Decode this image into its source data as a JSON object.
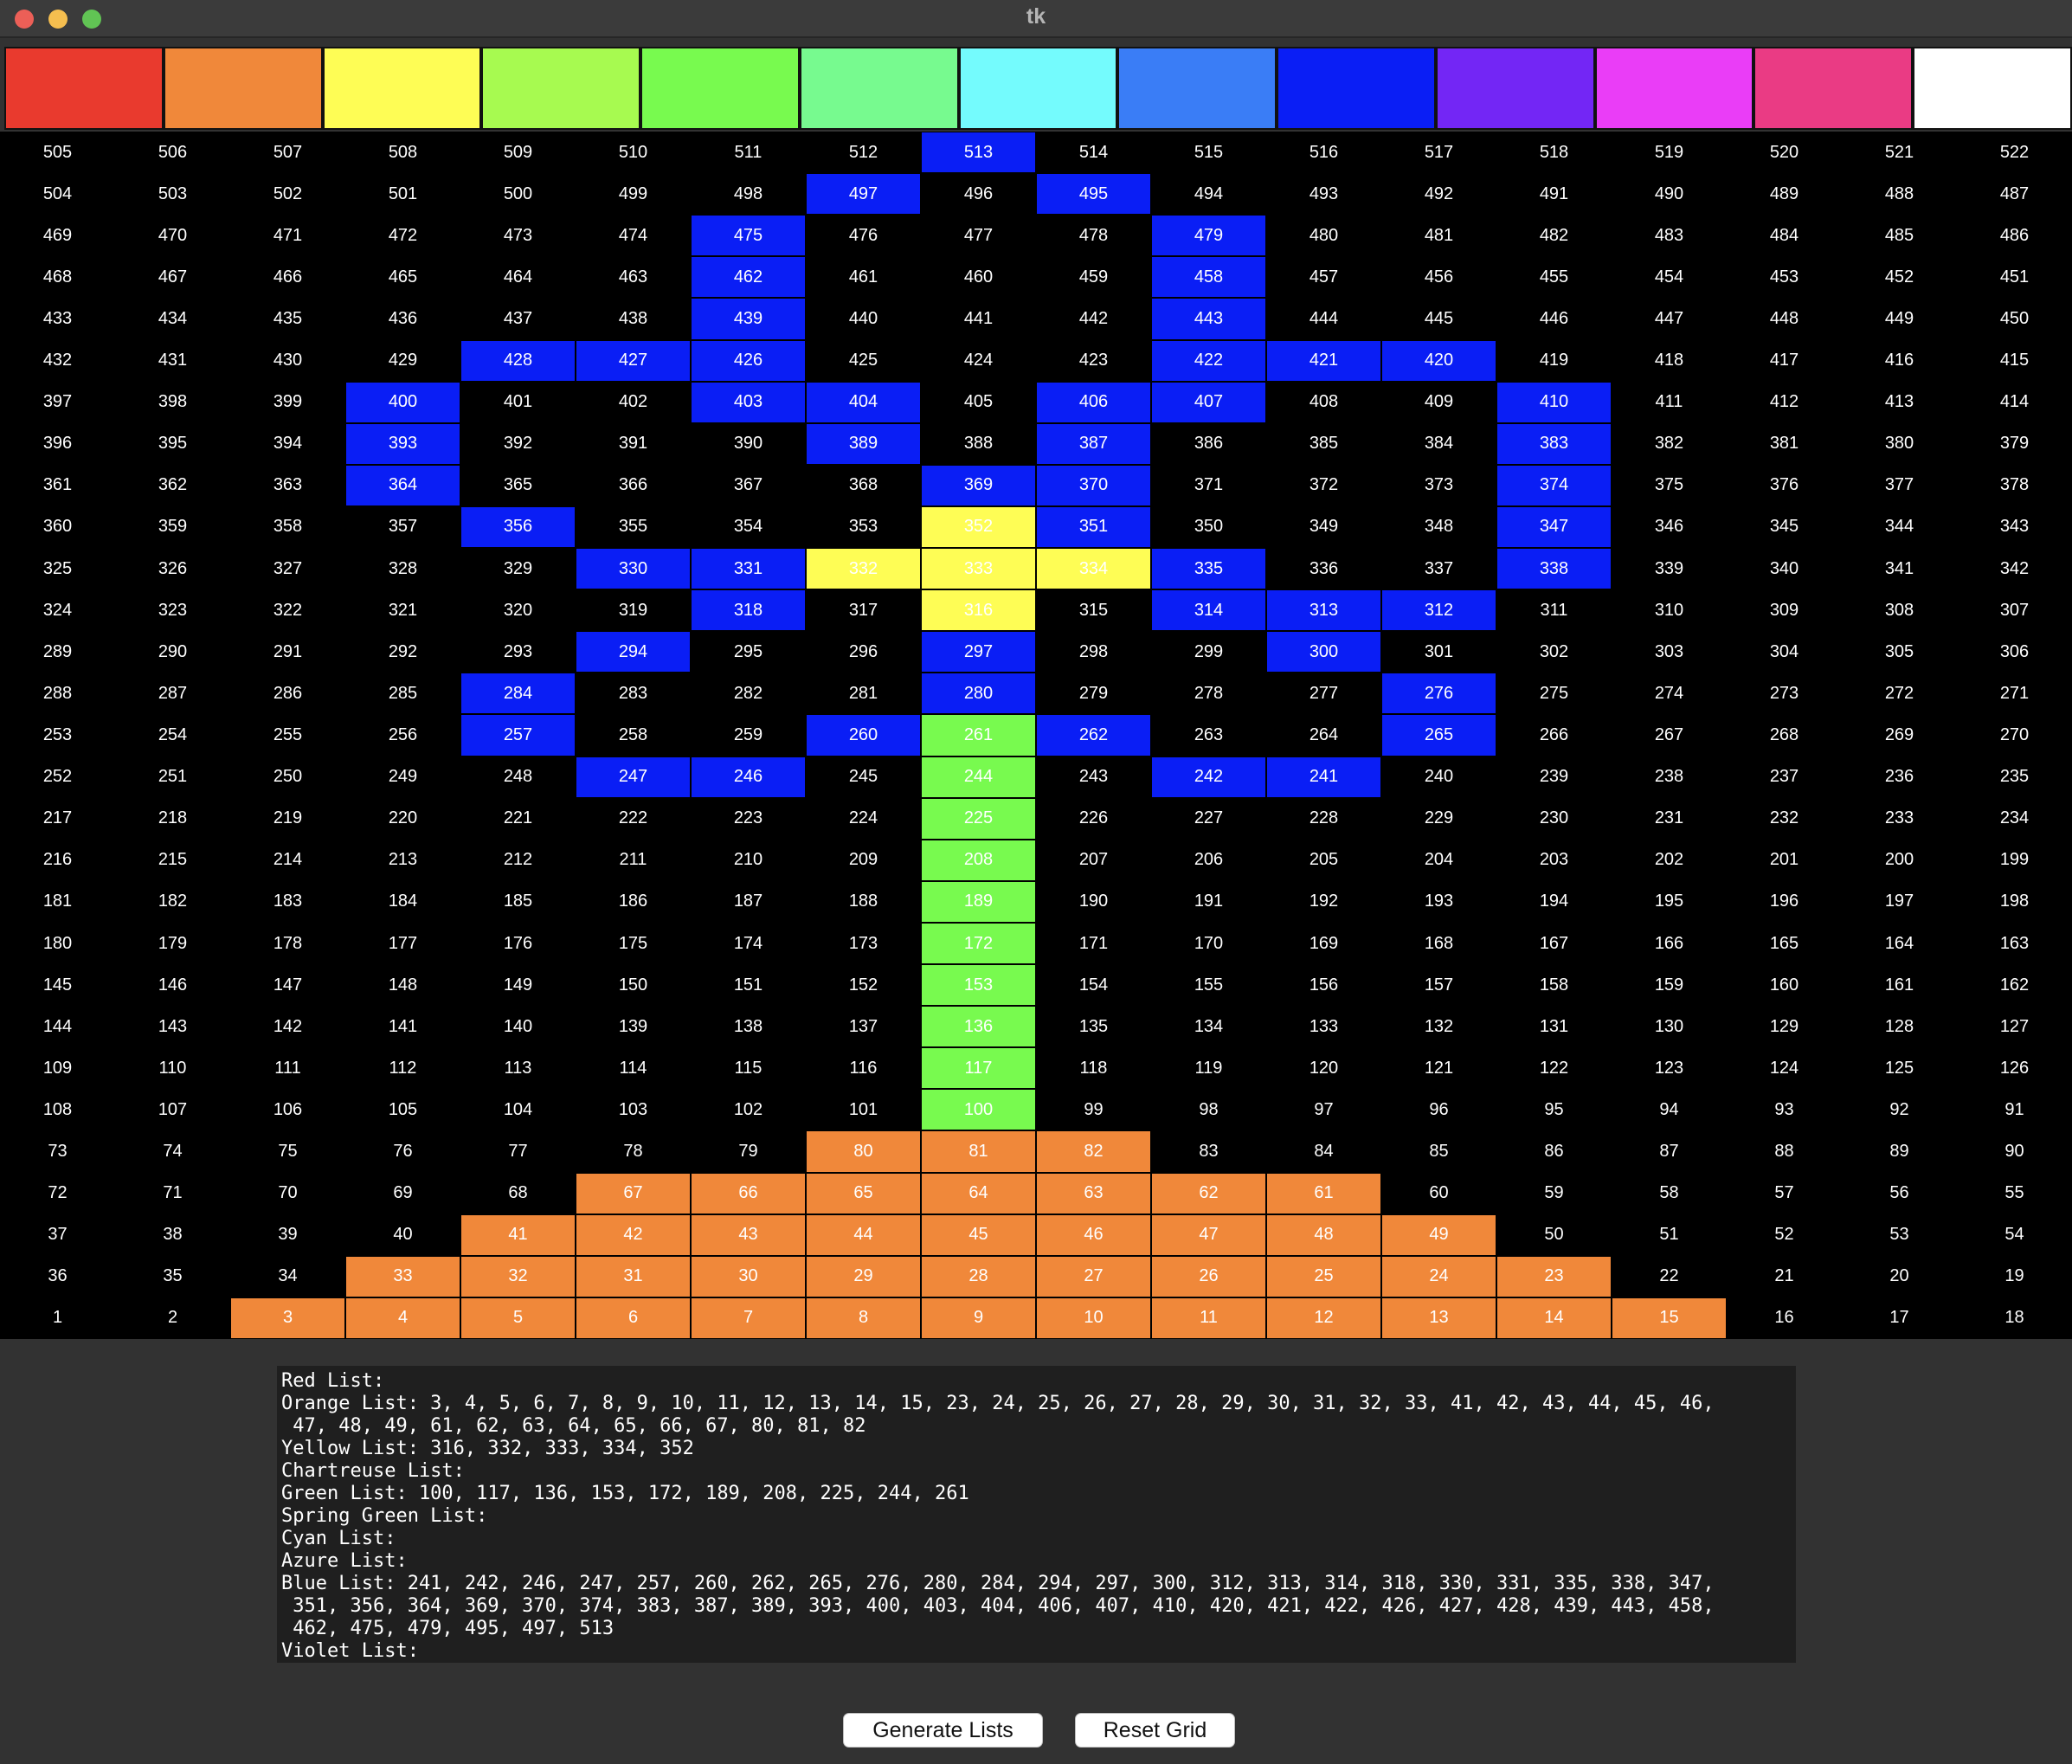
{
  "window": {
    "title": "tk",
    "lights": {
      "close": "#ec5f57",
      "minimize": "#f5be4f",
      "zoom": "#61c454"
    }
  },
  "palette": [
    {
      "name": "Red",
      "color": "#e93a2e"
    },
    {
      "name": "Orange",
      "color": "#f0883a"
    },
    {
      "name": "Yellow",
      "color": "#fefd55"
    },
    {
      "name": "Chartreuse",
      "color": "#a7fa50"
    },
    {
      "name": "Green",
      "color": "#78fa4f"
    },
    {
      "name": "Spring Green",
      "color": "#77fa8f"
    },
    {
      "name": "Cyan",
      "color": "#74fbfd"
    },
    {
      "name": "Azure",
      "color": "#3a7df6"
    },
    {
      "name": "Blue",
      "color": "#0a1ef5"
    },
    {
      "name": "Violet",
      "color": "#7326f5"
    },
    {
      "name": "Magenta",
      "color": "#ea3df7"
    },
    {
      "name": "Rose",
      "color": "#ea3b84"
    },
    {
      "name": "White",
      "color": "#ffffff"
    }
  ],
  "grid": {
    "rows": [
      [
        505,
        506,
        507,
        508,
        509,
        510,
        511,
        512,
        513,
        514,
        515,
        516,
        517,
        518,
        519,
        520,
        521,
        522
      ],
      [
        504,
        503,
        502,
        501,
        500,
        499,
        498,
        497,
        496,
        495,
        494,
        493,
        492,
        491,
        490,
        489,
        488,
        487
      ],
      [
        469,
        470,
        471,
        472,
        473,
        474,
        475,
        476,
        477,
        478,
        479,
        480,
        481,
        482,
        483,
        484,
        485,
        486
      ],
      [
        468,
        467,
        466,
        465,
        464,
        463,
        462,
        461,
        460,
        459,
        458,
        457,
        456,
        455,
        454,
        453,
        452,
        451
      ],
      [
        433,
        434,
        435,
        436,
        437,
        438,
        439,
        440,
        441,
        442,
        443,
        444,
        445,
        446,
        447,
        448,
        449,
        450
      ],
      [
        432,
        431,
        430,
        429,
        428,
        427,
        426,
        425,
        424,
        423,
        422,
        421,
        420,
        419,
        418,
        417,
        416,
        415
      ],
      [
        397,
        398,
        399,
        400,
        401,
        402,
        403,
        404,
        405,
        406,
        407,
        408,
        409,
        410,
        411,
        412,
        413,
        414
      ],
      [
        396,
        395,
        394,
        393,
        392,
        391,
        390,
        389,
        388,
        387,
        386,
        385,
        384,
        383,
        382,
        381,
        380,
        379
      ],
      [
        361,
        362,
        363,
        364,
        365,
        366,
        367,
        368,
        369,
        370,
        371,
        372,
        373,
        374,
        375,
        376,
        377,
        378
      ],
      [
        360,
        359,
        358,
        357,
        356,
        355,
        354,
        353,
        352,
        351,
        350,
        349,
        348,
        347,
        346,
        345,
        344,
        343
      ],
      [
        325,
        326,
        327,
        328,
        329,
        330,
        331,
        332,
        333,
        334,
        335,
        336,
        337,
        338,
        339,
        340,
        341,
        342
      ],
      [
        324,
        323,
        322,
        321,
        320,
        319,
        318,
        317,
        316,
        315,
        314,
        313,
        312,
        311,
        310,
        309,
        308,
        307
      ],
      [
        289,
        290,
        291,
        292,
        293,
        294,
        295,
        296,
        297,
        298,
        299,
        300,
        301,
        302,
        303,
        304,
        305,
        306
      ],
      [
        288,
        287,
        286,
        285,
        284,
        283,
        282,
        281,
        280,
        279,
        278,
        277,
        276,
        275,
        274,
        273,
        272,
        271
      ],
      [
        253,
        254,
        255,
        256,
        257,
        258,
        259,
        260,
        261,
        262,
        263,
        264,
        265,
        266,
        267,
        268,
        269,
        270
      ],
      [
        252,
        251,
        250,
        249,
        248,
        247,
        246,
        245,
        244,
        243,
        242,
        241,
        240,
        239,
        238,
        237,
        236,
        235
      ],
      [
        217,
        218,
        219,
        220,
        221,
        222,
        223,
        224,
        225,
        226,
        227,
        228,
        229,
        230,
        231,
        232,
        233,
        234
      ],
      [
        216,
        215,
        214,
        213,
        212,
        211,
        210,
        209,
        208,
        207,
        206,
        205,
        204,
        203,
        202,
        201,
        200,
        199
      ],
      [
        181,
        182,
        183,
        184,
        185,
        186,
        187,
        188,
        189,
        190,
        191,
        192,
        193,
        194,
        195,
        196,
        197,
        198
      ],
      [
        180,
        179,
        178,
        177,
        176,
        175,
        174,
        173,
        172,
        171,
        170,
        169,
        168,
        167,
        166,
        165,
        164,
        163
      ],
      [
        145,
        146,
        147,
        148,
        149,
        150,
        151,
        152,
        153,
        154,
        155,
        156,
        157,
        158,
        159,
        160,
        161,
        162
      ],
      [
        144,
        143,
        142,
        141,
        140,
        139,
        138,
        137,
        136,
        135,
        134,
        133,
        132,
        131,
        130,
        129,
        128,
        127
      ],
      [
        109,
        110,
        111,
        112,
        113,
        114,
        115,
        116,
        117,
        118,
        119,
        120,
        121,
        122,
        123,
        124,
        125,
        126
      ],
      [
        108,
        107,
        106,
        105,
        104,
        103,
        102,
        101,
        100,
        99,
        98,
        97,
        96,
        95,
        94,
        93,
        92,
        91
      ],
      [
        73,
        74,
        75,
        76,
        77,
        78,
        79,
        80,
        81,
        82,
        83,
        84,
        85,
        86,
        87,
        88,
        89,
        90
      ],
      [
        72,
        71,
        70,
        69,
        68,
        67,
        66,
        65,
        64,
        63,
        62,
        61,
        60,
        59,
        58,
        57,
        56,
        55
      ],
      [
        37,
        38,
        39,
        40,
        41,
        42,
        43,
        44,
        45,
        46,
        47,
        48,
        49,
        50,
        51,
        52,
        53,
        54
      ],
      [
        36,
        35,
        34,
        33,
        32,
        31,
        30,
        29,
        28,
        27,
        26,
        25,
        24,
        23,
        22,
        21,
        20,
        19
      ],
      [
        1,
        2,
        3,
        4,
        5,
        6,
        7,
        8,
        9,
        10,
        11,
        12,
        13,
        14,
        15,
        16,
        17,
        18
      ]
    ],
    "colored": {
      "orange": [
        3,
        4,
        5,
        6,
        7,
        8,
        9,
        10,
        11,
        12,
        13,
        14,
        15,
        23,
        24,
        25,
        26,
        27,
        28,
        29,
        30,
        31,
        32,
        33,
        41,
        42,
        43,
        44,
        45,
        46,
        47,
        48,
        49,
        61,
        62,
        63,
        64,
        65,
        66,
        67,
        80,
        81,
        82
      ],
      "yellow": [
        316,
        332,
        333,
        334,
        352
      ],
      "green": [
        100,
        117,
        136,
        153,
        172,
        189,
        208,
        225,
        244,
        261
      ],
      "blue": [
        241,
        242,
        246,
        247,
        257,
        260,
        262,
        265,
        276,
        280,
        284,
        294,
        297,
        300,
        312,
        313,
        314,
        318,
        330,
        331,
        335,
        338,
        347,
        351,
        356,
        364,
        369,
        370,
        374,
        383,
        387,
        389,
        393,
        400,
        403,
        404,
        406,
        407,
        410,
        420,
        421,
        422,
        426,
        427,
        428,
        439,
        443,
        458,
        462,
        475,
        479,
        495,
        497,
        513
      ]
    },
    "fills": {
      "orange": "#f0883a",
      "yellow": "#fefd55",
      "green": "#78fa4f",
      "blue": "#0a1ef5"
    }
  },
  "output": {
    "lines": [
      "Red List:",
      "Orange List: 3, 4, 5, 6, 7, 8, 9, 10, 11, 12, 13, 14, 15, 23, 24, 25, 26, 27, 28, 29, 30, 31, 32, 33, 41, 42, 43, 44, 45, 46,",
      " 47, 48, 49, 61, 62, 63, 64, 65, 66, 67, 80, 81, 82",
      "Yellow List: 316, 332, 333, 334, 352",
      "Chartreuse List:",
      "Green List: 100, 117, 136, 153, 172, 189, 208, 225, 244, 261",
      "Spring Green List:",
      "Cyan List:",
      "Azure List:",
      "Blue List: 241, 242, 246, 247, 257, 260, 262, 265, 276, 280, 284, 294, 297, 300, 312, 313, 314, 318, 330, 331, 335, 338, 347,",
      " 351, 356, 364, 369, 370, 374, 383, 387, 389, 393, 400, 403, 404, 406, 407, 410, 420, 421, 422, 426, 427, 428, 439, 443, 458,",
      " 462, 475, 479, 495, 497, 513",
      "Violet List:"
    ]
  },
  "buttons": {
    "generate": "Generate Lists",
    "reset": "Reset Grid"
  }
}
